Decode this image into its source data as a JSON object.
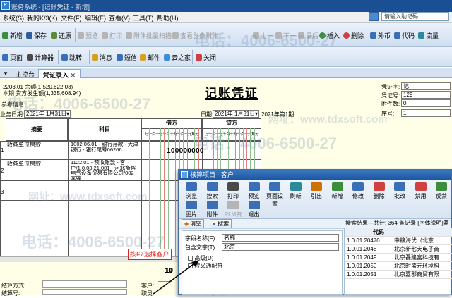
{
  "window": {
    "title": "账务系统 - [记账凭证 - 新增]",
    "search_placeholder": "请输入助记码"
  },
  "menu": [
    "系统(S)",
    "我的K/3(K)",
    "文件(F)",
    "编辑(E)",
    "查看(V)",
    "工具(T)",
    "帮助(H)"
  ],
  "toolbar1": [
    {
      "label": "新增",
      "enabled": true,
      "icon": "new-icon"
    },
    {
      "label": "保存",
      "enabled": true,
      "icon": "save-icon"
    },
    {
      "label": "还原",
      "enabled": true,
      "icon": "undo-icon"
    },
    {
      "label": "预览",
      "enabled": false,
      "icon": "preview-icon"
    },
    {
      "label": "打印",
      "enabled": false,
      "icon": "print-icon"
    },
    {
      "label": "附件批量扫描",
      "enabled": false,
      "icon": "scan-icon"
    },
    {
      "label": "查看影像附件",
      "enabled": false,
      "icon": "image-icon"
    },
    {
      "label": "上一",
      "enabled": false,
      "icon": "prev-icon"
    },
    {
      "label": "下一",
      "enabled": false,
      "icon": "next-icon"
    },
    {
      "label": "最后",
      "enabled": false,
      "icon": "last-icon"
    },
    {
      "label": "插入",
      "enabled": true,
      "icon": "insert-icon"
    },
    {
      "label": "删除",
      "enabled": true,
      "icon": "delete-icon"
    },
    {
      "label": "外币",
      "enabled": true,
      "icon": "currency-icon"
    },
    {
      "label": "代码",
      "enabled": true,
      "icon": "code-icon"
    },
    {
      "label": "流量",
      "enabled": true,
      "icon": "flow-icon"
    }
  ],
  "toolbar2": [
    {
      "label": "页面",
      "icon": "page-icon"
    },
    {
      "label": "计算器",
      "icon": "calculator-icon"
    },
    {
      "label": "跳转",
      "icon": "jump-icon"
    },
    {
      "label": "消息",
      "icon": "message-icon"
    },
    {
      "label": "短信",
      "icon": "sms-icon"
    },
    {
      "label": "邮件",
      "icon": "mail-icon"
    },
    {
      "label": "云之家",
      "icon": "cloud-icon"
    },
    {
      "label": "关闭",
      "icon": "close-icon"
    }
  ],
  "tabs": [
    {
      "label": "主控台"
    },
    {
      "label": "凭证录入"
    }
  ],
  "voucher": {
    "period_line": "2203.01  余额(1,520,622.03)",
    "period_amount": "本期  贷方发生额(1,335,608.94)",
    "title": "记账凭证",
    "ref_label": "参考信息:",
    "biz_date_label": "业务日期:",
    "biz_date": "2021年 1月31日",
    "date_label": "日期:",
    "date": "2021年 1月31日",
    "period": "2021年第1期",
    "word_label": "凭证字:",
    "word_value": "记",
    "no_label": "凭证号:",
    "no_value": "129",
    "attach_label": "附件数:",
    "attach_value": "0",
    "seq_label": "序号:",
    "seq_value": "1",
    "col_summary": "摘要",
    "col_account": "科目",
    "col_debit": "借方",
    "col_credit": "贷方",
    "digit_header": "万千百十亿千百十万千百十元角分",
    "rows": [
      {
        "no": "1",
        "summary": "收各单位房款",
        "account": "1002.06.01 - 银行存款 - 天津银行 - 银行尾号06266",
        "debit": "100000000",
        "credit": ""
      },
      {
        "no": "2",
        "summary": "收各单位房款",
        "account": "1122.01 - 预收账款 - 客户/1.0.03.21.001 - 河北衡裕电气设备贸易有限公司/002 - 李锋",
        "debit": "",
        "credit": ""
      },
      {
        "no": "3",
        "summary": "",
        "account": "",
        "debit": "",
        "credit": ""
      }
    ],
    "total_debit": "10",
    "settle_label": "结算方式:",
    "settle_no_label": "结算号:",
    "customer_label": "客户:",
    "position_label": "职员:"
  },
  "callout": "按F7选择客户",
  "dialog": {
    "title": "核算项目 - 客户",
    "toolbar": [
      {
        "label": "浏览",
        "icon": "browse-icon"
      },
      {
        "label": "搜索",
        "icon": "search-icon"
      },
      {
        "label": "打印",
        "icon": "print-icon"
      },
      {
        "label": "预览",
        "icon": "preview-icon"
      },
      {
        "label": "页面设置",
        "icon": "page-setup-icon"
      },
      {
        "label": "刷新",
        "icon": "refresh-icon"
      },
      {
        "label": "引出",
        "icon": "export-icon"
      },
      {
        "label": "新增",
        "icon": "new-icon"
      },
      {
        "label": "修改",
        "icon": "edit-icon"
      },
      {
        "label": "删除",
        "icon": "delete-icon"
      },
      {
        "label": "批改",
        "icon": "batch-edit-icon"
      },
      {
        "label": "禁用",
        "icon": "disable-icon"
      },
      {
        "label": "反禁",
        "icon": "enable-icon"
      }
    ],
    "toolbar_row2": [
      {
        "label": "图片",
        "icon": "picture-icon",
        "enabled": true
      },
      {
        "label": "附件",
        "icon": "attachment-icon",
        "enabled": true
      },
      {
        "label": "PLM资料",
        "icon": "plm-icon",
        "enabled": false
      },
      {
        "label": "退出",
        "icon": "exit-icon",
        "enabled": true
      }
    ],
    "clear_btn": "清空",
    "search_btn": "搜索",
    "field_label": "字段名称(F)",
    "field_value": "名称",
    "contains_label": "包含文字(T)",
    "contains_value": "北京",
    "advanced_label": "高级(D)",
    "traditional_label": "转义通配符",
    "result_summary": "搜索结果—共计: 364 条记录  [字体说明]蓝",
    "result_col_code": "代码",
    "results": [
      {
        "code": "1.0.01.20470",
        "name": "中粮海优（北京"
      },
      {
        "code": "1.0.01.2048",
        "name": "北京新七天电子商"
      },
      {
        "code": "1.0.01.2049",
        "name": "北京磊建富科技有"
      },
      {
        "code": "1.0.01.2050",
        "name": "北京时盛元环境科"
      },
      {
        "code": "1.0.01.2051",
        "name": "北京嘉郡商贸有限"
      }
    ]
  },
  "watermarks": {
    "phone": "电话：4006-6500-27",
    "site": "网址：www.tdxsoft.com"
  },
  "colors": {
    "title_bar": "#1b4f93",
    "toolbar_bg": "#dbe7f4",
    "voucher_bg": "#ffffe8",
    "callout": "#e02020"
  }
}
